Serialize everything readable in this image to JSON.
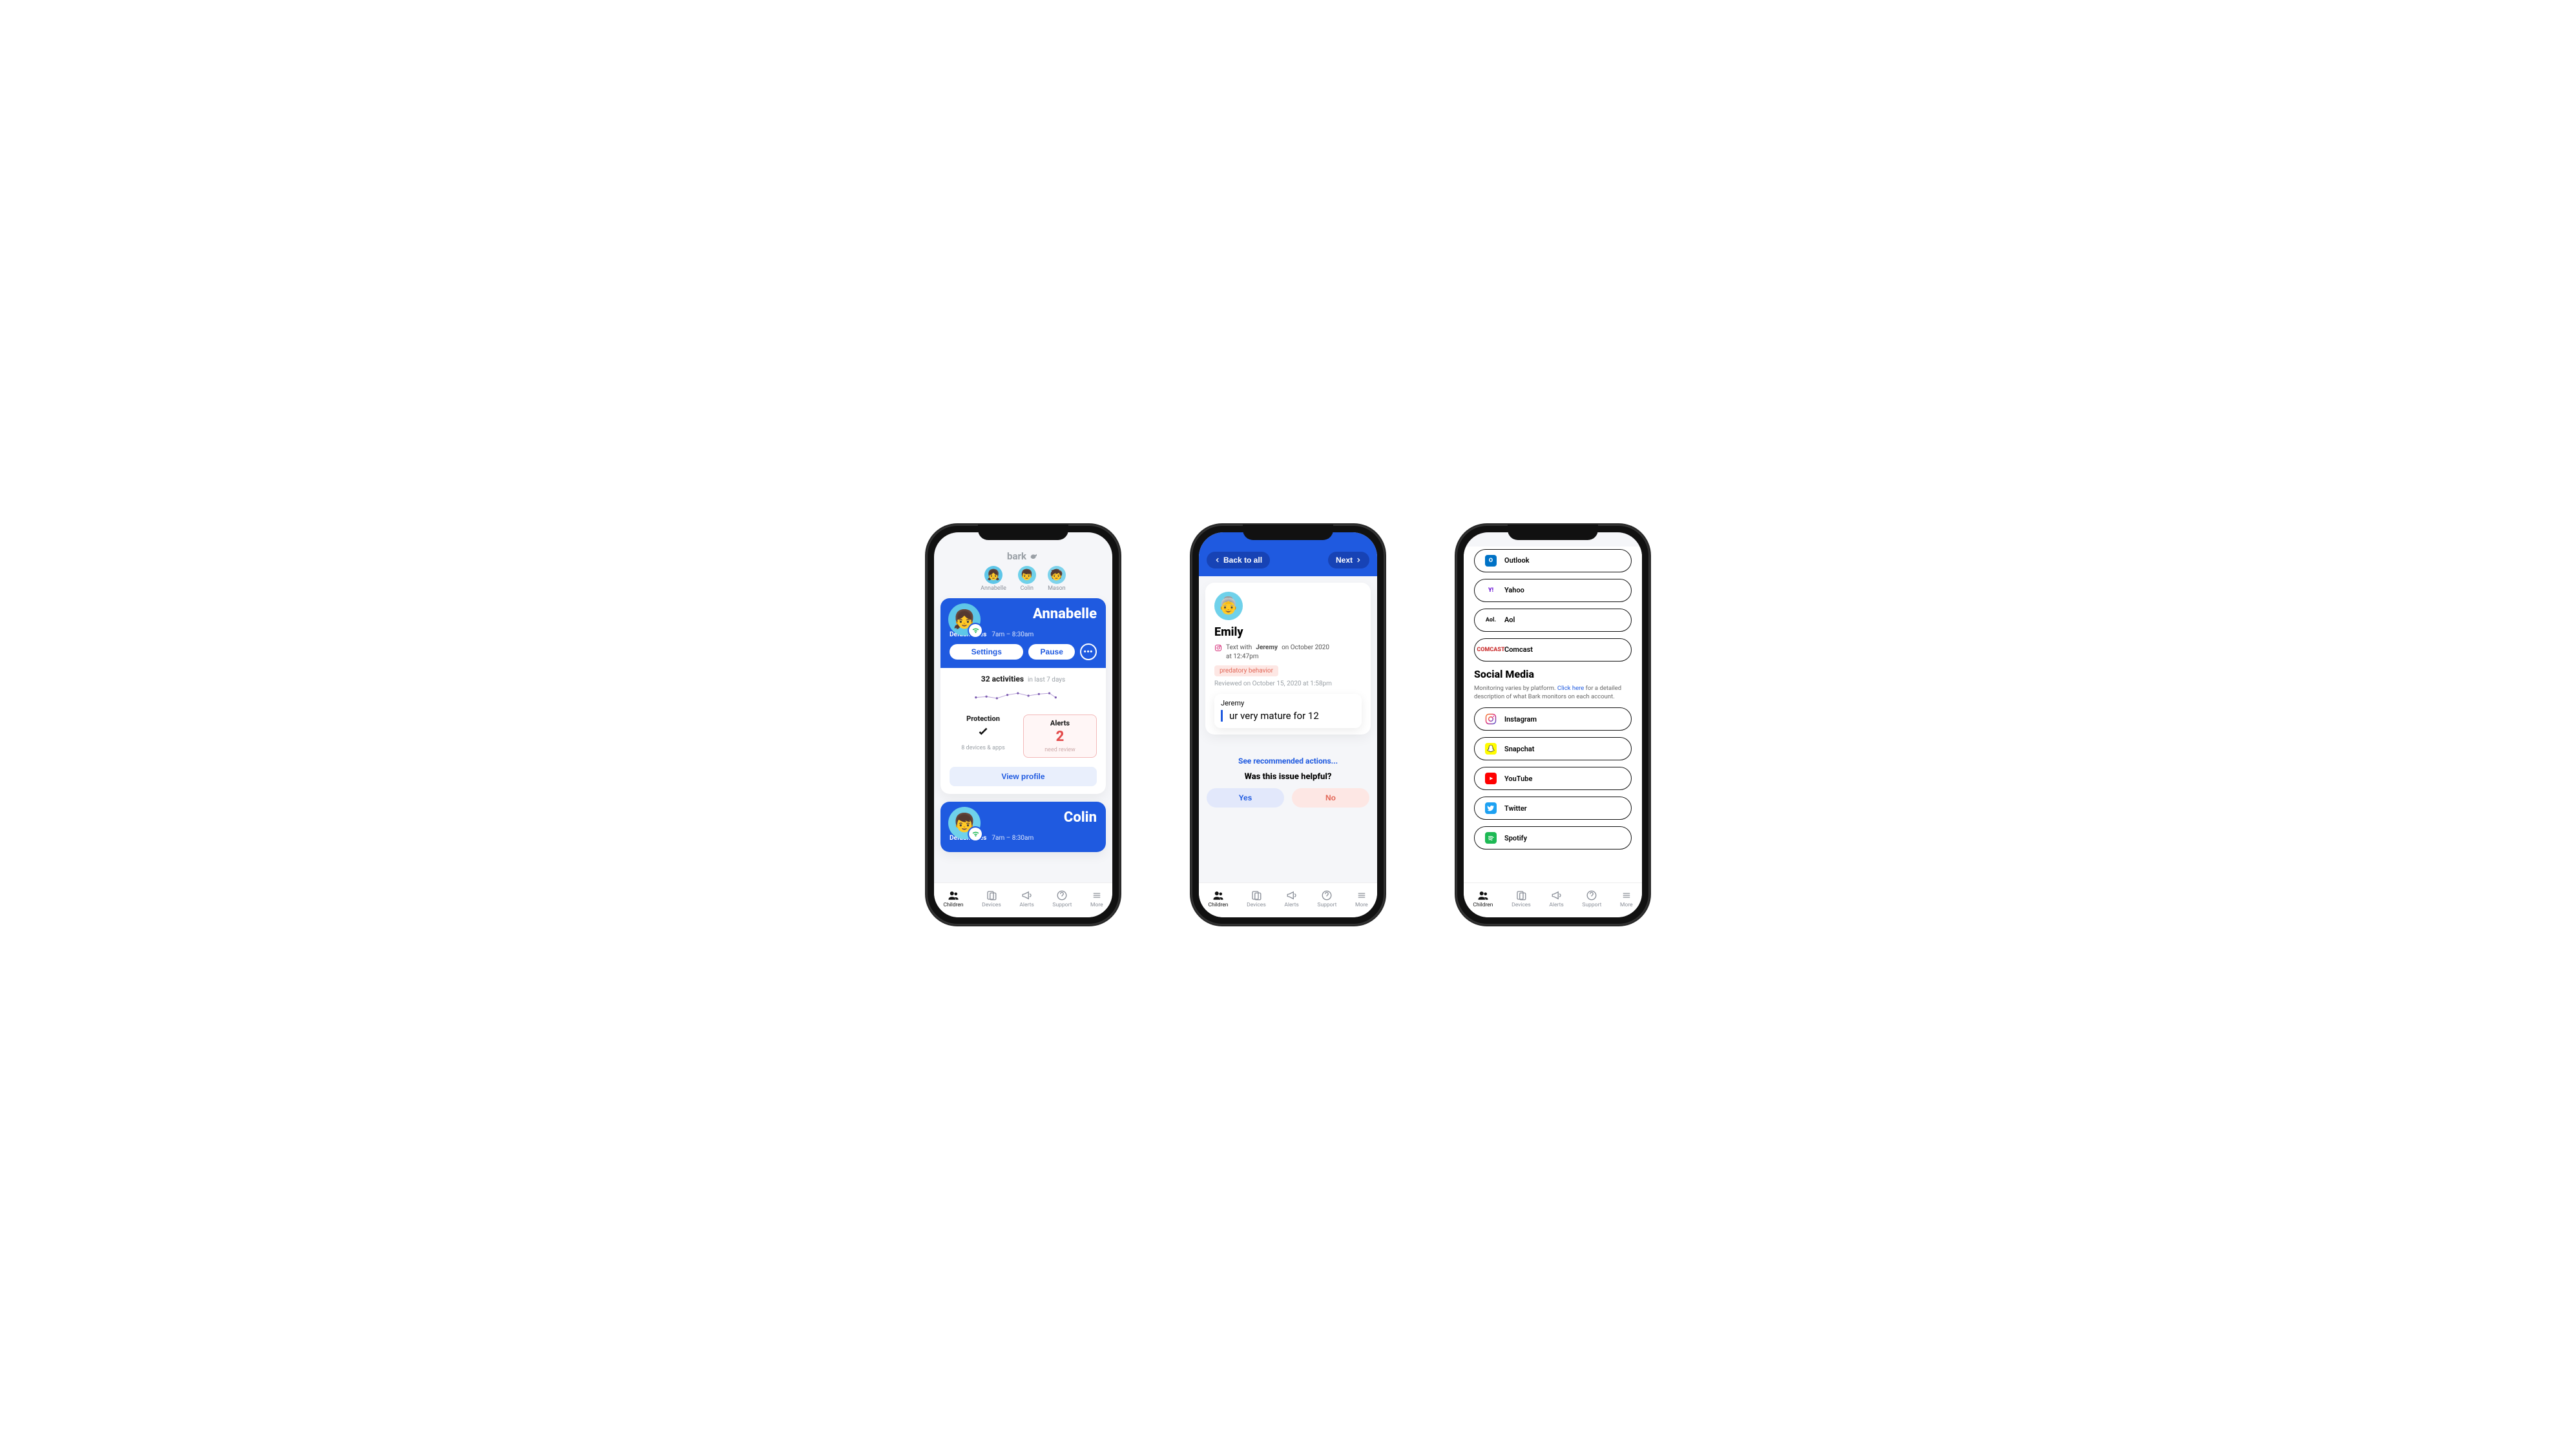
{
  "brand": "bark",
  "kids": [
    {
      "name": "Annabelle"
    },
    {
      "name": "Colin"
    },
    {
      "name": "Mason"
    }
  ],
  "tabs": [
    {
      "label": "Children",
      "active": true
    },
    {
      "label": "Devices"
    },
    {
      "label": "Alerts"
    },
    {
      "label": "Support"
    },
    {
      "label": "More"
    }
  ],
  "screen1": {
    "children": [
      {
        "name": "Annabelle",
        "rules_label": "Default rules",
        "rules_time": "7am – 8:30am",
        "settings_label": "Settings",
        "pause_label": "Pause",
        "activities_count": "32 activities",
        "activities_sub": "in last 7 days",
        "protection_label": "Protection",
        "protection_sub": "8 devices & apps",
        "alerts_label": "Alerts",
        "alerts_count": "2",
        "alerts_sub": "need review",
        "view_profile": "View profile"
      },
      {
        "name": "Colin",
        "rules_label": "Default rules",
        "rules_time": "7am – 8:30am"
      }
    ]
  },
  "screen2": {
    "back": "Back to all",
    "next": "Next",
    "child": "Emily",
    "meta_prefix": "Text with",
    "meta_name": "Jeremy",
    "meta_suffix_1": "on October 2020",
    "meta_suffix_2": "at 12:47pm",
    "flag": "predatory behavior",
    "reviewed": "Reviewed on October 15, 2020 at 1:58pm",
    "message_from": "Jeremy",
    "message_body": "ur very mature for 12",
    "rec_link": "See recommended actions...",
    "helpful_q": "Was this issue helpful?",
    "yes": "Yes",
    "no": "No"
  },
  "screen3": {
    "email_services": [
      {
        "name": "Outlook"
      },
      {
        "name": "Yahoo"
      },
      {
        "name": "Aol"
      },
      {
        "name": "Comcast"
      }
    ],
    "section_title": "Social Media",
    "section_desc_1": "Monitoring varies by platform. ",
    "section_link": "Click here",
    "section_desc_2": " for a detailed description of what Bark monitors on each account.",
    "social_services": [
      {
        "name": "Instagram"
      },
      {
        "name": "Snapchat"
      },
      {
        "name": "YouTube"
      },
      {
        "name": "Twitter"
      },
      {
        "name": "Spotify"
      }
    ]
  }
}
